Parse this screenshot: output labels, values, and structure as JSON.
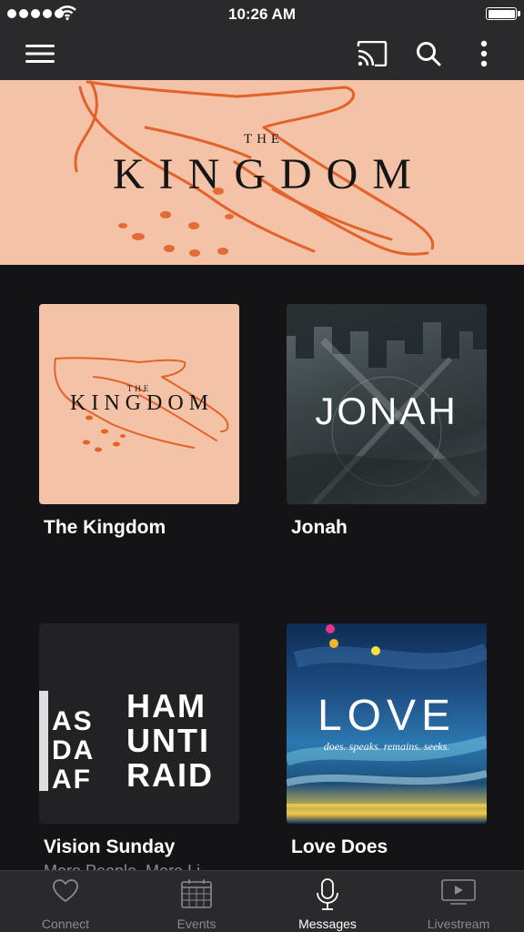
{
  "status_bar": {
    "time": "10:26 AM"
  },
  "hero": {
    "small_text": "THE",
    "title": "KINGDOM"
  },
  "grid": {
    "items": [
      {
        "title": "The Kingdom",
        "art_small": "THE",
        "art_text": "KINGDOM"
      },
      {
        "title": "Jonah",
        "art_text": "JONAH"
      },
      {
        "title": "Vision Sunday",
        "subtitle": "More People. More Li",
        "art_lines": [
          "HAM",
          "UNTI",
          "RAID",
          "AS",
          "DA",
          "AF"
        ]
      },
      {
        "title": "Love Does",
        "art_text": "LOVE",
        "art_tagline": "does. speaks. remains. seeks."
      }
    ]
  },
  "tabs": [
    {
      "label": "Connect",
      "icon": "heart-icon",
      "active": false
    },
    {
      "label": "Events",
      "icon": "calendar-icon",
      "active": false
    },
    {
      "label": "Messages",
      "icon": "microphone-icon",
      "active": true
    },
    {
      "label": "Livestream",
      "icon": "tv-play-icon",
      "active": false
    }
  ],
  "colors": {
    "bar_bg": "#2a2a2c",
    "page_bg": "#141416",
    "kingdom_peach": "#f4c3a7",
    "kingdom_orange": "#e2622a",
    "tab_inactive": "#8b8b8f"
  }
}
